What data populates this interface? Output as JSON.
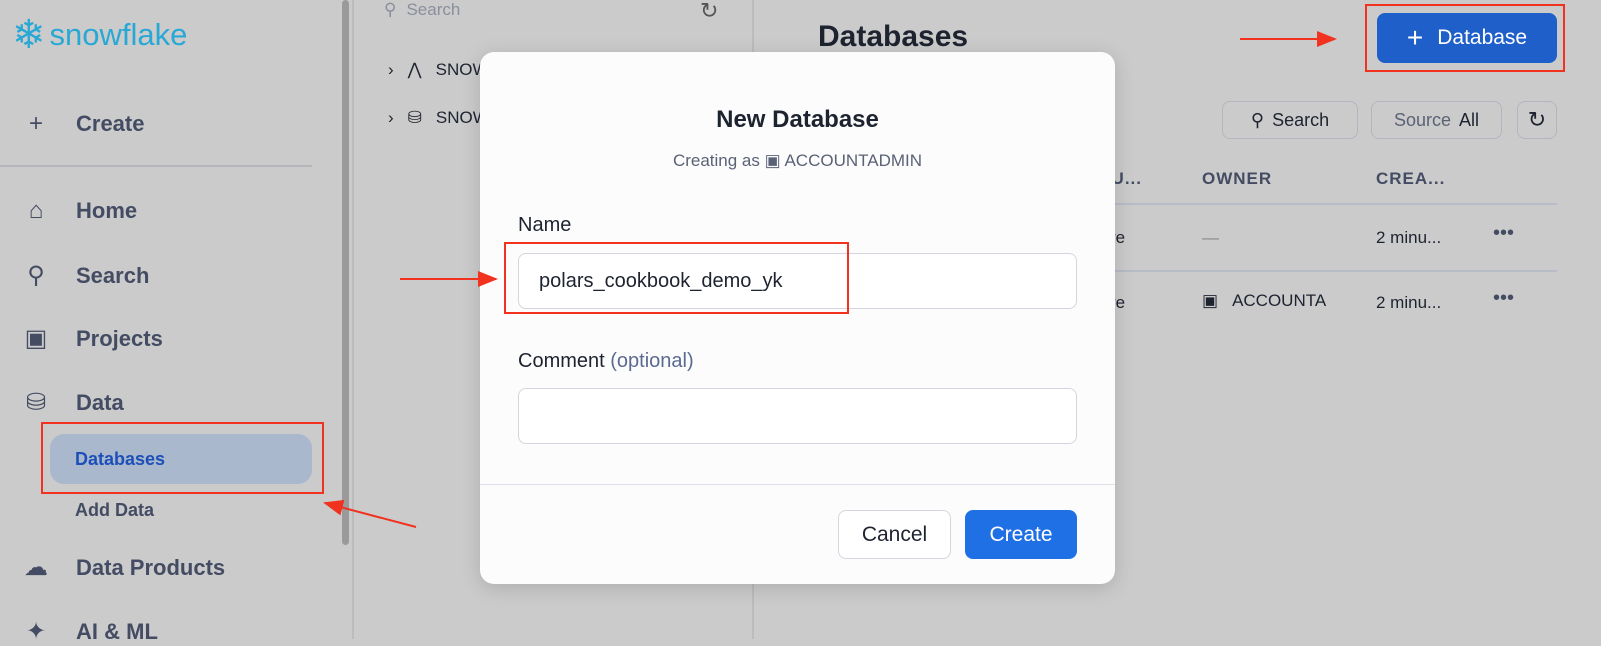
{
  "sidebar": {
    "logo": "snowflake",
    "create": "Create",
    "items": [
      {
        "label": "Home",
        "icon": "home-icon"
      },
      {
        "label": "Search",
        "icon": "search-icon"
      },
      {
        "label": "Projects",
        "icon": "terminal-icon"
      },
      {
        "label": "Data",
        "icon": "database-icon"
      }
    ],
    "sub_items": [
      "Databases",
      "Add Data"
    ],
    "data_products": "Data Products",
    "ai_ml": "AI & ML"
  },
  "tree": {
    "search_placeholder": "Search",
    "items": [
      "SNOWFLAKE",
      "SNOWFLAKE_SAMPLE_DATA"
    ]
  },
  "main": {
    "title": "Databases",
    "add_button": "Database",
    "search": "Search",
    "source_label": "Source",
    "source_value": "All",
    "columns": [
      "SOU...",
      "OWNER",
      "CREA..."
    ],
    "rows": [
      {
        "source": "re",
        "owner": "—",
        "created": "2 minu..."
      },
      {
        "source": "re",
        "owner": "ACCOUNTA",
        "created": "2 minu..."
      }
    ]
  },
  "modal": {
    "title": "New Database",
    "creating_as": "Creating as",
    "role": "ACCOUNTADMIN",
    "name_label": "Name",
    "name_value": "polars_cookbook_demo_yk",
    "comment_label": "Comment",
    "comment_optional": "(optional)",
    "comment_value": "",
    "cancel": "Cancel",
    "create": "Create"
  },
  "colors": {
    "accent": "#1f6fe5",
    "annotation": "#f0321e",
    "logo": "#29a8d6"
  }
}
